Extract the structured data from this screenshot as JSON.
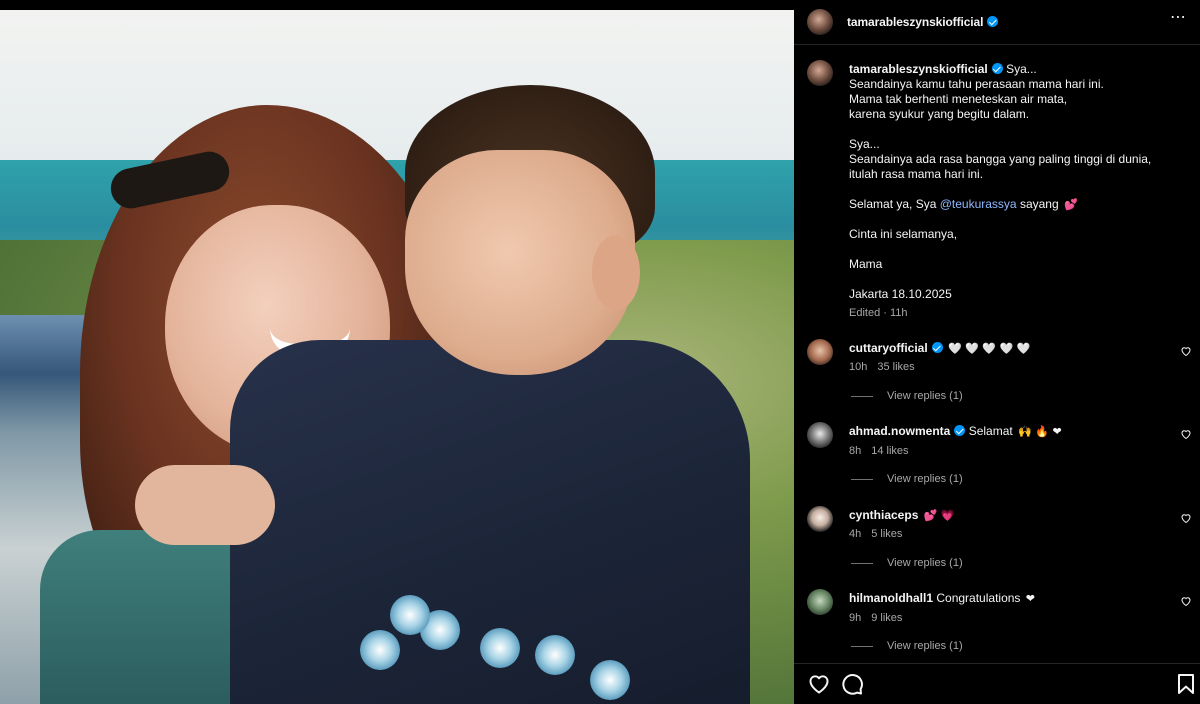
{
  "header": {
    "username": "tamarableszynskiofficial",
    "more_label": "⋯"
  },
  "caption": {
    "username": "tamarableszynskiofficial",
    "lines": [
      "Sya...",
      "Seandainya kamu tahu perasaan mama hari ini.",
      "Mama tak berhenti meneteskan air mata,",
      "karena syukur yang begitu dalam.",
      "Sya...",
      "Seandainya ada rasa bangga yang paling tinggi di dunia,",
      "itulah rasa mama hari ini.",
      "Selamat ya, Sya",
      "@teukurassya",
      "sayang",
      "Cinta ini selamanya,",
      "Mama",
      "Jakarta 18.10.2025"
    ],
    "edited": "Edited · 11h"
  },
  "comments": [
    {
      "username": "cuttaryofficial",
      "verified": true,
      "text": "",
      "emoji": "🤍 🤍 🤍 🤍 🤍",
      "time": "10h",
      "likes": "35 likes",
      "replies": "View replies (1)"
    },
    {
      "username": "ahmad.nowmenta",
      "verified": true,
      "text": "Selamat",
      "emoji": "🙌 🔥 ❤",
      "time": "8h",
      "likes": "14 likes",
      "replies": "View replies (1)"
    },
    {
      "username": "cynthiaceps",
      "verified": false,
      "text": "",
      "emoji": "💕 💗",
      "time": "4h",
      "likes": "5 likes",
      "replies": "View replies (1)"
    },
    {
      "username": "hilmanoldhall1",
      "verified": false,
      "text": "Congratulations",
      "emoji": "❤",
      "time": "9h",
      "likes": "9 likes",
      "replies": "View replies (1)"
    }
  ],
  "caption_emoji": "💕",
  "icons": {
    "like": "heart-icon",
    "comment": "comment-icon",
    "save": "bookmark-icon",
    "more": "more-options-icon",
    "verified": "verified-badge-icon"
  },
  "colors": {
    "background": "#000000",
    "verified": "#0095f6",
    "secondary_text": "#a8a8a8",
    "mention": "#8fb9ff"
  }
}
